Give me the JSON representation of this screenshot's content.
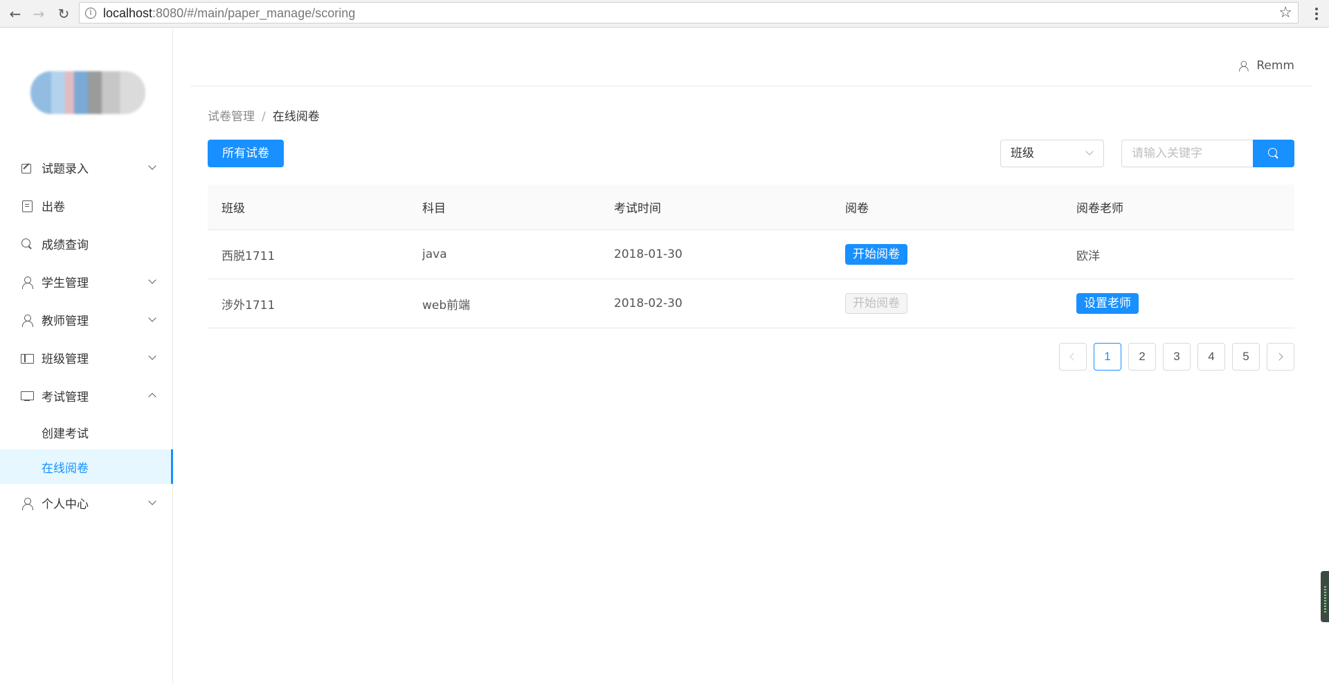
{
  "browser": {
    "url_host": "localhost",
    "url_rest": ":8080/#/main/paper_manage/scoring"
  },
  "sidebar": {
    "items": [
      {
        "label": "试题录入",
        "icon": "edit-icon",
        "expandable": true
      },
      {
        "label": "出卷",
        "icon": "document-icon",
        "expandable": false
      },
      {
        "label": "成绩查询",
        "icon": "search-icon",
        "expandable": false
      },
      {
        "label": "学生管理",
        "icon": "student-icon",
        "expandable": true
      },
      {
        "label": "教师管理",
        "icon": "teacher-icon",
        "expandable": true
      },
      {
        "label": "班级管理",
        "icon": "table-icon",
        "expandable": true
      },
      {
        "label": "考试管理",
        "icon": "monitor-icon",
        "expandable": true,
        "expanded": true
      },
      {
        "label": "创建考试",
        "sub": true
      },
      {
        "label": "在线阅卷",
        "sub": true,
        "active": true
      },
      {
        "label": "个人中心",
        "icon": "user-icon",
        "expandable": true
      }
    ]
  },
  "header": {
    "username": "Remm"
  },
  "breadcrumb": {
    "parent": "试卷管理",
    "separator": "/",
    "current": "在线阅卷"
  },
  "toolbar": {
    "all_papers_label": "所有试卷",
    "class_select_value": "班级",
    "search_placeholder": "请输入关键字"
  },
  "table": {
    "headers": [
      "班级",
      "科目",
      "考试时间",
      "阅卷",
      "阅卷老师"
    ],
    "rows": [
      {
        "class": "西脱1711",
        "subject": "java",
        "time": "2018-01-30",
        "action": "开始阅卷",
        "action_enabled": true,
        "teacher": "欧洋"
      },
      {
        "class": "涉外1711",
        "subject": "web前端",
        "time": "2018-02-30",
        "action": "开始阅卷",
        "action_enabled": false,
        "teacher_button": "设置老师"
      }
    ]
  },
  "pagination": {
    "pages": [
      "1",
      "2",
      "3",
      "4",
      "5"
    ],
    "current": "1"
  },
  "colors": {
    "primary": "#1890ff",
    "active_bg": "#e6f7ff"
  }
}
